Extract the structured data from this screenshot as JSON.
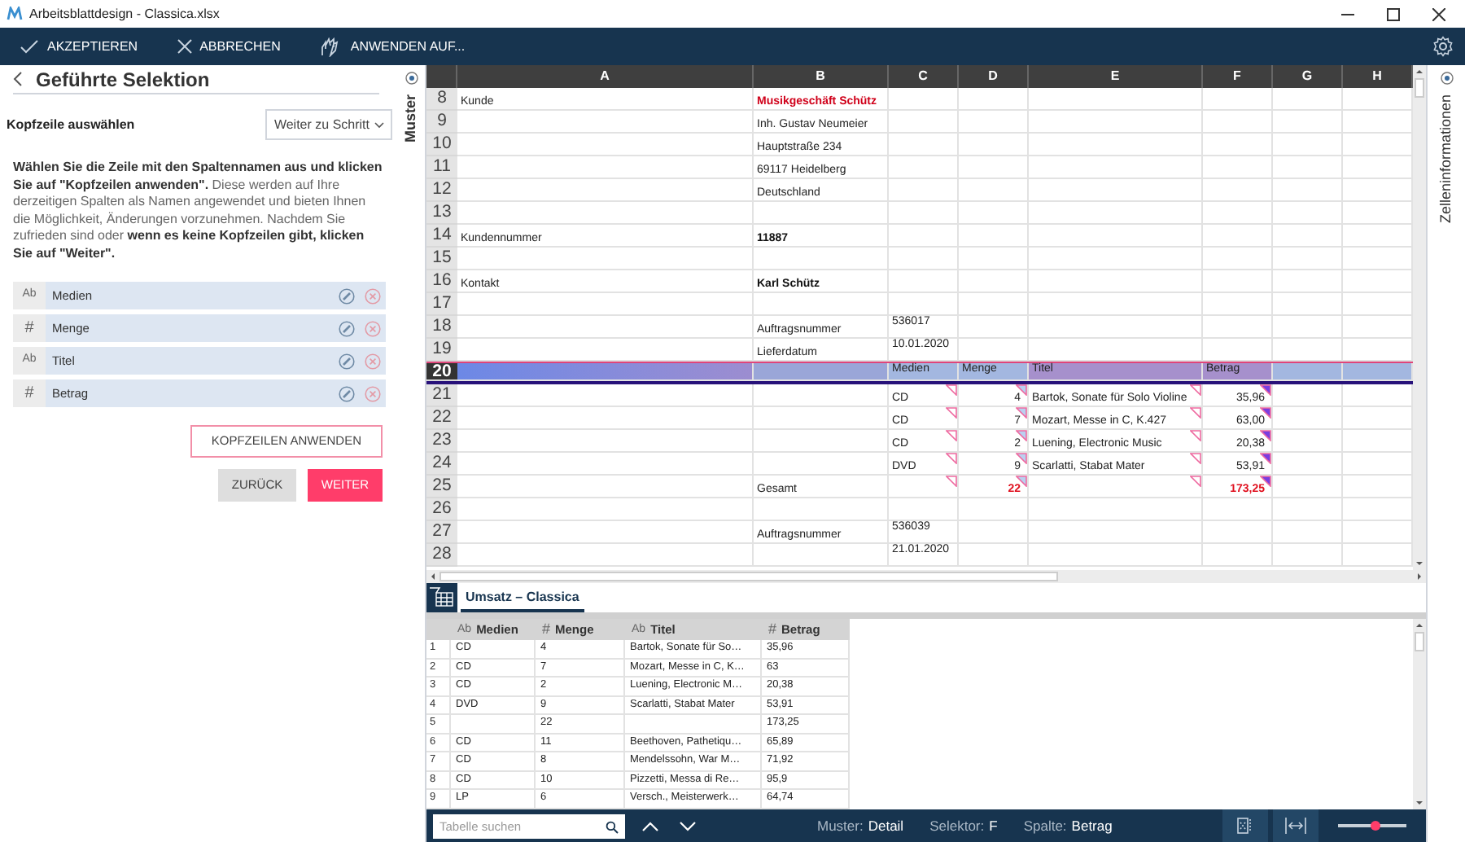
{
  "window": {
    "title": "Arbeitsblattdesign - Classica.xlsx"
  },
  "toolbar": {
    "actions": [
      {
        "kind": "accept",
        "label": "AKZEPTIEREN"
      },
      {
        "kind": "cancel",
        "label": "ABBRECHEN"
      },
      {
        "kind": "apply",
        "label": "ANWENDEN AUF..."
      }
    ]
  },
  "guide_panel": {
    "title": "Geführte Selektion",
    "step_label": "Kopfzeile auswählen",
    "step_dropdown": "Weiter zu Schritt",
    "instructions": "**Wählen Sie die Zeile mit den Spaltennamen aus und klicken Sie auf \"Kopfzeilen anwenden\".** Diese werden auf Ihre derzeitigen Spalten als Namen angewendet und bieten Ihnen die Möglichkeit, Änderungen vorzunehmen. Nachdem Sie zufrieden sind oder **wenn es keine Kopfzeilen gibt, klicken Sie auf \"Weiter\".**",
    "headers": [
      {
        "kind": "text",
        "type_label": "Ab",
        "name": "Medien"
      },
      {
        "kind": "number",
        "type_label": "#",
        "name": "Menge"
      },
      {
        "kind": "text",
        "type_label": "Ab",
        "name": "Titel"
      },
      {
        "kind": "number",
        "type_label": "#",
        "name": "Betrag"
      }
    ],
    "apply_button": "KOPFZEILEN ANWENDEN",
    "back_button": "ZURÜCK",
    "next_button": "WEITER"
  },
  "pattern_pane": {
    "label": "Muster"
  },
  "sheet": {
    "columns": [
      "A",
      "B",
      "C",
      "D",
      "E",
      "F",
      "G",
      "H"
    ],
    "rows": [
      {
        "number": "8",
        "selected": false,
        "markers": false,
        "cells": {
          "A": {
            "kind": "text",
            "text": "Kunde"
          },
          "B": {
            "kind": "accent",
            "text": "Musikgeschäft Schütz"
          }
        }
      },
      {
        "number": "9",
        "selected": false,
        "markers": false,
        "cells": {
          "B": {
            "kind": "text",
            "text": "Inh. Gustav Neumeier"
          }
        }
      },
      {
        "number": "10",
        "selected": false,
        "markers": false,
        "cells": {
          "B": {
            "kind": "text",
            "text": "Hauptstraße 234"
          }
        }
      },
      {
        "number": "11",
        "selected": false,
        "markers": false,
        "cells": {
          "B": {
            "kind": "text",
            "text": "69117 Heidelberg"
          }
        }
      },
      {
        "number": "12",
        "selected": false,
        "markers": false,
        "cells": {
          "B": {
            "kind": "text",
            "text": "Deutschland"
          }
        }
      },
      {
        "number": "13",
        "selected": false,
        "markers": false
      },
      {
        "number": "14",
        "selected": false,
        "markers": false,
        "cells": {
          "A": {
            "kind": "text",
            "text": "Kundennummer"
          },
          "B": {
            "kind": "bold",
            "text": "11887"
          }
        }
      },
      {
        "number": "15",
        "selected": false,
        "markers": false
      },
      {
        "number": "16",
        "selected": false,
        "markers": false,
        "cells": {
          "A": {
            "kind": "text",
            "text": "Kontakt"
          },
          "B": {
            "kind": "bold",
            "text": "Karl Schütz"
          }
        }
      },
      {
        "number": "17",
        "selected": false,
        "markers": false
      },
      {
        "number": "18",
        "selected": false,
        "markers": false,
        "cells": {
          "B": {
            "kind": "text",
            "text": "Auftragsnummer"
          },
          "C": {
            "kind": "top",
            "text": "536017"
          }
        }
      },
      {
        "number": "19",
        "selected": false,
        "markers": false,
        "cells": {
          "B": {
            "kind": "text",
            "text": "Lieferdatum"
          },
          "C": {
            "kind": "top",
            "text": "10.01.2020"
          }
        }
      },
      {
        "number": "20",
        "selected": true,
        "markers": false,
        "cells": {
          "C": {
            "kind": "top",
            "text": "Medien"
          },
          "D": {
            "kind": "top",
            "text": "Menge"
          },
          "E": {
            "kind": "top",
            "text": "Titel"
          },
          "F": {
            "kind": "top",
            "text": "Betrag"
          }
        }
      },
      {
        "number": "21",
        "selected": false,
        "markers": true,
        "cells": {
          "C": {
            "kind": "text",
            "text": "CD"
          },
          "D": {
            "kind": "number",
            "text": "4"
          },
          "E": {
            "kind": "text",
            "text": "Bartok, Sonate für Solo Violine"
          },
          "F": {
            "kind": "number",
            "text": "35,96"
          }
        }
      },
      {
        "number": "22",
        "selected": false,
        "markers": true,
        "cells": {
          "C": {
            "kind": "text",
            "text": "CD"
          },
          "D": {
            "kind": "number",
            "text": "7"
          },
          "E": {
            "kind": "text",
            "text": "Mozart, Messe in C, K.427"
          },
          "F": {
            "kind": "number",
            "text": "63,00"
          }
        }
      },
      {
        "number": "23",
        "selected": false,
        "markers": true,
        "cells": {
          "C": {
            "kind": "text",
            "text": "CD"
          },
          "D": {
            "kind": "number",
            "text": "2"
          },
          "E": {
            "kind": "text",
            "text": "Luening, Electronic Music"
          },
          "F": {
            "kind": "number",
            "text": "20,38"
          }
        }
      },
      {
        "number": "24",
        "selected": false,
        "markers": true,
        "cells": {
          "C": {
            "kind": "text",
            "text": "DVD"
          },
          "D": {
            "kind": "number",
            "text": "9"
          },
          "E": {
            "kind": "text",
            "text": "Scarlatti, Stabat Mater"
          },
          "F": {
            "kind": "number",
            "text": "53,91"
          }
        }
      },
      {
        "number": "25",
        "selected": false,
        "markers": true,
        "cells": {
          "B": {
            "kind": "text",
            "text": "Gesamt"
          },
          "D": {
            "kind": "total",
            "text": "22"
          },
          "F": {
            "kind": "total",
            "text": "173,25"
          }
        }
      },
      {
        "number": "26",
        "selected": false,
        "markers": false
      },
      {
        "number": "27",
        "selected": false,
        "markers": false,
        "cells": {
          "B": {
            "kind": "text",
            "text": "Auftragsnummer"
          },
          "C": {
            "kind": "top",
            "text": "536039"
          }
        }
      },
      {
        "number": "28",
        "selected": false,
        "markers": false,
        "cells": {
          "C": {
            "kind": "top",
            "text": "21.01.2020"
          }
        }
      }
    ],
    "tab": "Umsatz – Classica"
  },
  "info_pane": {
    "label": "Zelleninformationen"
  },
  "preview_table": {
    "columns": [
      {
        "kind": "text",
        "type_label": "Ab",
        "name": "Medien"
      },
      {
        "kind": "number",
        "type_label": "#",
        "name": "Menge"
      },
      {
        "kind": "text",
        "type_label": "Ab",
        "name": "Titel"
      },
      {
        "kind": "number",
        "type_label": "#",
        "name": "Betrag"
      }
    ],
    "rows": [
      {
        "number": "1",
        "medien": "CD",
        "menge": "4",
        "titel": "Bartok, Sonate für So…",
        "betrag": "35,96"
      },
      {
        "number": "2",
        "medien": "CD",
        "menge": "7",
        "titel": "Mozart, Messe in C, K…",
        "betrag": "63"
      },
      {
        "number": "3",
        "medien": "CD",
        "menge": "2",
        "titel": "Luening, Electronic M…",
        "betrag": "20,38"
      },
      {
        "number": "4",
        "medien": "DVD",
        "menge": "9",
        "titel": "Scarlatti, Stabat Mater",
        "betrag": "53,91"
      },
      {
        "number": "5",
        "menge": "22",
        "betrag": "173,25"
      },
      {
        "number": "6",
        "medien": "CD",
        "menge": "11",
        "titel": "Beethoven, Pathetiqu…",
        "betrag": "65,89"
      },
      {
        "number": "7",
        "medien": "CD",
        "menge": "8",
        "titel": "Mendelssohn, War M…",
        "betrag": "71,92"
      },
      {
        "number": "8",
        "medien": "CD",
        "menge": "10",
        "titel": "Pizzetti, Messa di Re…",
        "betrag": "95,9"
      },
      {
        "number": "9",
        "medien": "LP",
        "menge": "6",
        "titel": "Versch., Meisterwerk…",
        "betrag": "64,74"
      }
    ]
  },
  "status_bar": {
    "search_placeholder": "Tabelle suchen",
    "items": [
      {
        "label": "Muster:",
        "value": "Detail"
      },
      {
        "label": "Selektor:",
        "value": "F"
      },
      {
        "label": "Spalte:",
        "value": "Betrag"
      }
    ],
    "zoom": {
      "level": 0.55
    }
  }
}
